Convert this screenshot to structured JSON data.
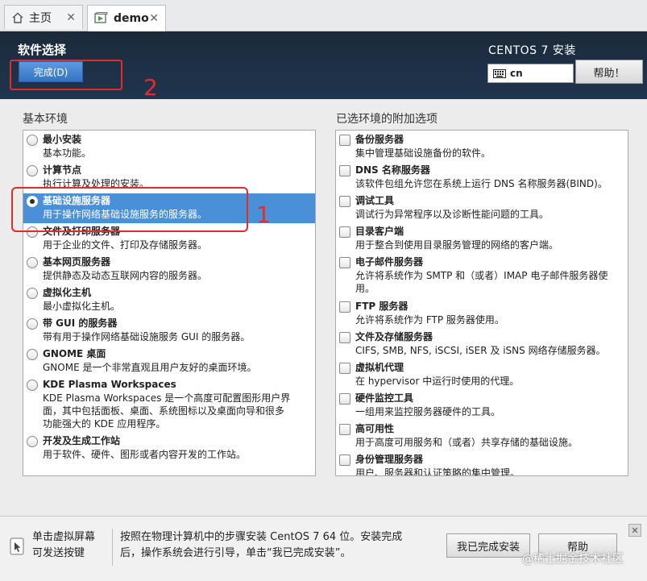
{
  "tabs": [
    {
      "label": "主页",
      "icon": "home-icon",
      "active": false
    },
    {
      "label": "demo",
      "icon": "vm-icon",
      "active": true
    }
  ],
  "header": {
    "title": "软件选择",
    "done_label": "完成(D)",
    "os_title": "CENTOS 7 安装",
    "keyboard_layout": "cn",
    "help_label": "帮助！"
  },
  "annotations": {
    "one": "1",
    "two": "2"
  },
  "base_env": {
    "title": "基本环境",
    "items": [
      {
        "name": "最小安装",
        "desc": [
          "基本功能。"
        ],
        "selected": false
      },
      {
        "name": "计算节点",
        "desc": [
          "执行计算及处理的安装。"
        ],
        "selected": false
      },
      {
        "name": "基础设施服务器",
        "desc": [
          "用于操作网络基础设施服务的服务器。"
        ],
        "selected": true
      },
      {
        "name": "文件及打印服务器",
        "desc": [
          "用于企业的文件、打印及存储服务器。"
        ],
        "selected": false
      },
      {
        "name": "基本网页服务器",
        "desc": [
          "提供静态及动态互联网内容的服务器。"
        ],
        "selected": false
      },
      {
        "name": "虚拟化主机",
        "desc": [
          "最小虚拟化主机。"
        ],
        "selected": false
      },
      {
        "name": "带 GUI 的服务器",
        "desc": [
          "带有用于操作网络基础设施服务 GUI 的服务器。"
        ],
        "selected": false
      },
      {
        "name": "GNOME 桌面",
        "desc": [
          "GNOME 是一个非常直观且用户友好的桌面环境。"
        ],
        "selected": false
      },
      {
        "name": "KDE Plasma Workspaces",
        "desc": [
          "KDE Plasma Workspaces 是一个高度可配置图形用户界",
          "面，其中包括面板、桌面、系统图标以及桌面向导和很多",
          "功能强大的 KDE 应用程序。"
        ],
        "selected": false
      },
      {
        "name": "开发及生成工作站",
        "desc": [
          "用于软件、硬件、图形或者内容开发的工作站。"
        ],
        "selected": false
      }
    ]
  },
  "addons": {
    "title": "已选环境的附加选项",
    "items": [
      {
        "name": "备份服务器",
        "desc": [
          "集中管理基础设施备份的软件。"
        ]
      },
      {
        "name": "DNS 名称服务器",
        "desc": [
          "该软件包组允许您在系统上运行 DNS 名称服务器(BIND)。"
        ]
      },
      {
        "name": "调试工具",
        "desc": [
          "调试行为异常程序以及诊断性能问题的工具。"
        ]
      },
      {
        "name": "目录客户端",
        "desc": [
          "用于整合到使用目录服务管理的网络的客户端。"
        ]
      },
      {
        "name": "电子邮件服务器",
        "desc": [
          "允许将系统作为 SMTP 和（或者）IMAP 电子邮件服务器使",
          "用。"
        ]
      },
      {
        "name": "FTP 服务器",
        "desc": [
          "允许将系统作为 FTP 服务器使用。"
        ]
      },
      {
        "name": "文件及存储服务器",
        "desc": [
          "CIFS, SMB, NFS, iSCSI, iSER 及 iSNS 网络存储服务器。"
        ]
      },
      {
        "name": "虚拟机代理",
        "desc": [
          "在 hypervisor 中运行时使用的代理。"
        ]
      },
      {
        "name": "硬件监控工具",
        "desc": [
          "一组用来监控服务器硬件的工具。"
        ]
      },
      {
        "name": "高可用性",
        "desc": [
          "用于高度可用服务和（或者）共享存储的基础设施。"
        ]
      },
      {
        "name": "身份管理服务器",
        "desc": [
          "用户、服务器和认证策略的集中管理。"
        ]
      }
    ]
  },
  "bottom": {
    "hint_line1": "单击虚拟屏幕",
    "hint_line2": "可发送按键",
    "info_line1": "按照在物理计算机中的步骤安装 CentOS 7 64 位。安装完成",
    "info_line2": "后，操作系统会进行引导，单击“我已完成安装”。",
    "done_install_label": "我已完成安装",
    "help_label": "帮助"
  },
  "watermark": "@稀土掘金技术社区",
  "colors": {
    "header_bg": "#1e3148",
    "selection": "#4a90d9",
    "accent_button": "#3474c4",
    "annotation": "#e52a2a"
  }
}
